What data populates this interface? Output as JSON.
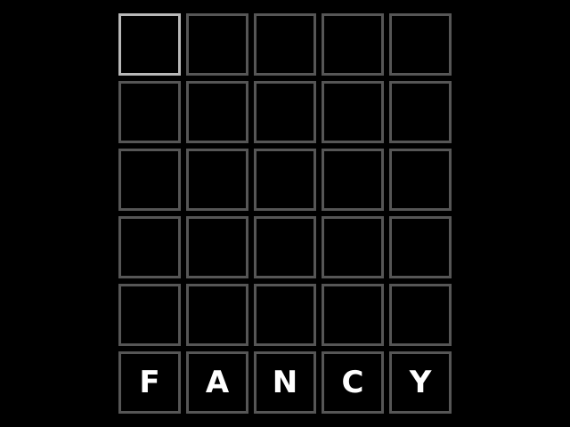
{
  "colors": {
    "background": "#000000",
    "tile_border": "#565656",
    "active_tile_border": "#b8b8b8",
    "letter": "#ffffff"
  },
  "board": {
    "rows": [
      [
        "",
        "",
        "",
        "",
        ""
      ],
      [
        "",
        "",
        "",
        "",
        ""
      ],
      [
        "",
        "",
        "",
        "",
        ""
      ],
      [
        "",
        "",
        "",
        "",
        ""
      ],
      [
        "",
        "",
        "",
        "",
        ""
      ],
      [
        "F",
        "A",
        "N",
        "C",
        "Y"
      ]
    ],
    "active": {
      "row": 0,
      "col": 0
    }
  }
}
